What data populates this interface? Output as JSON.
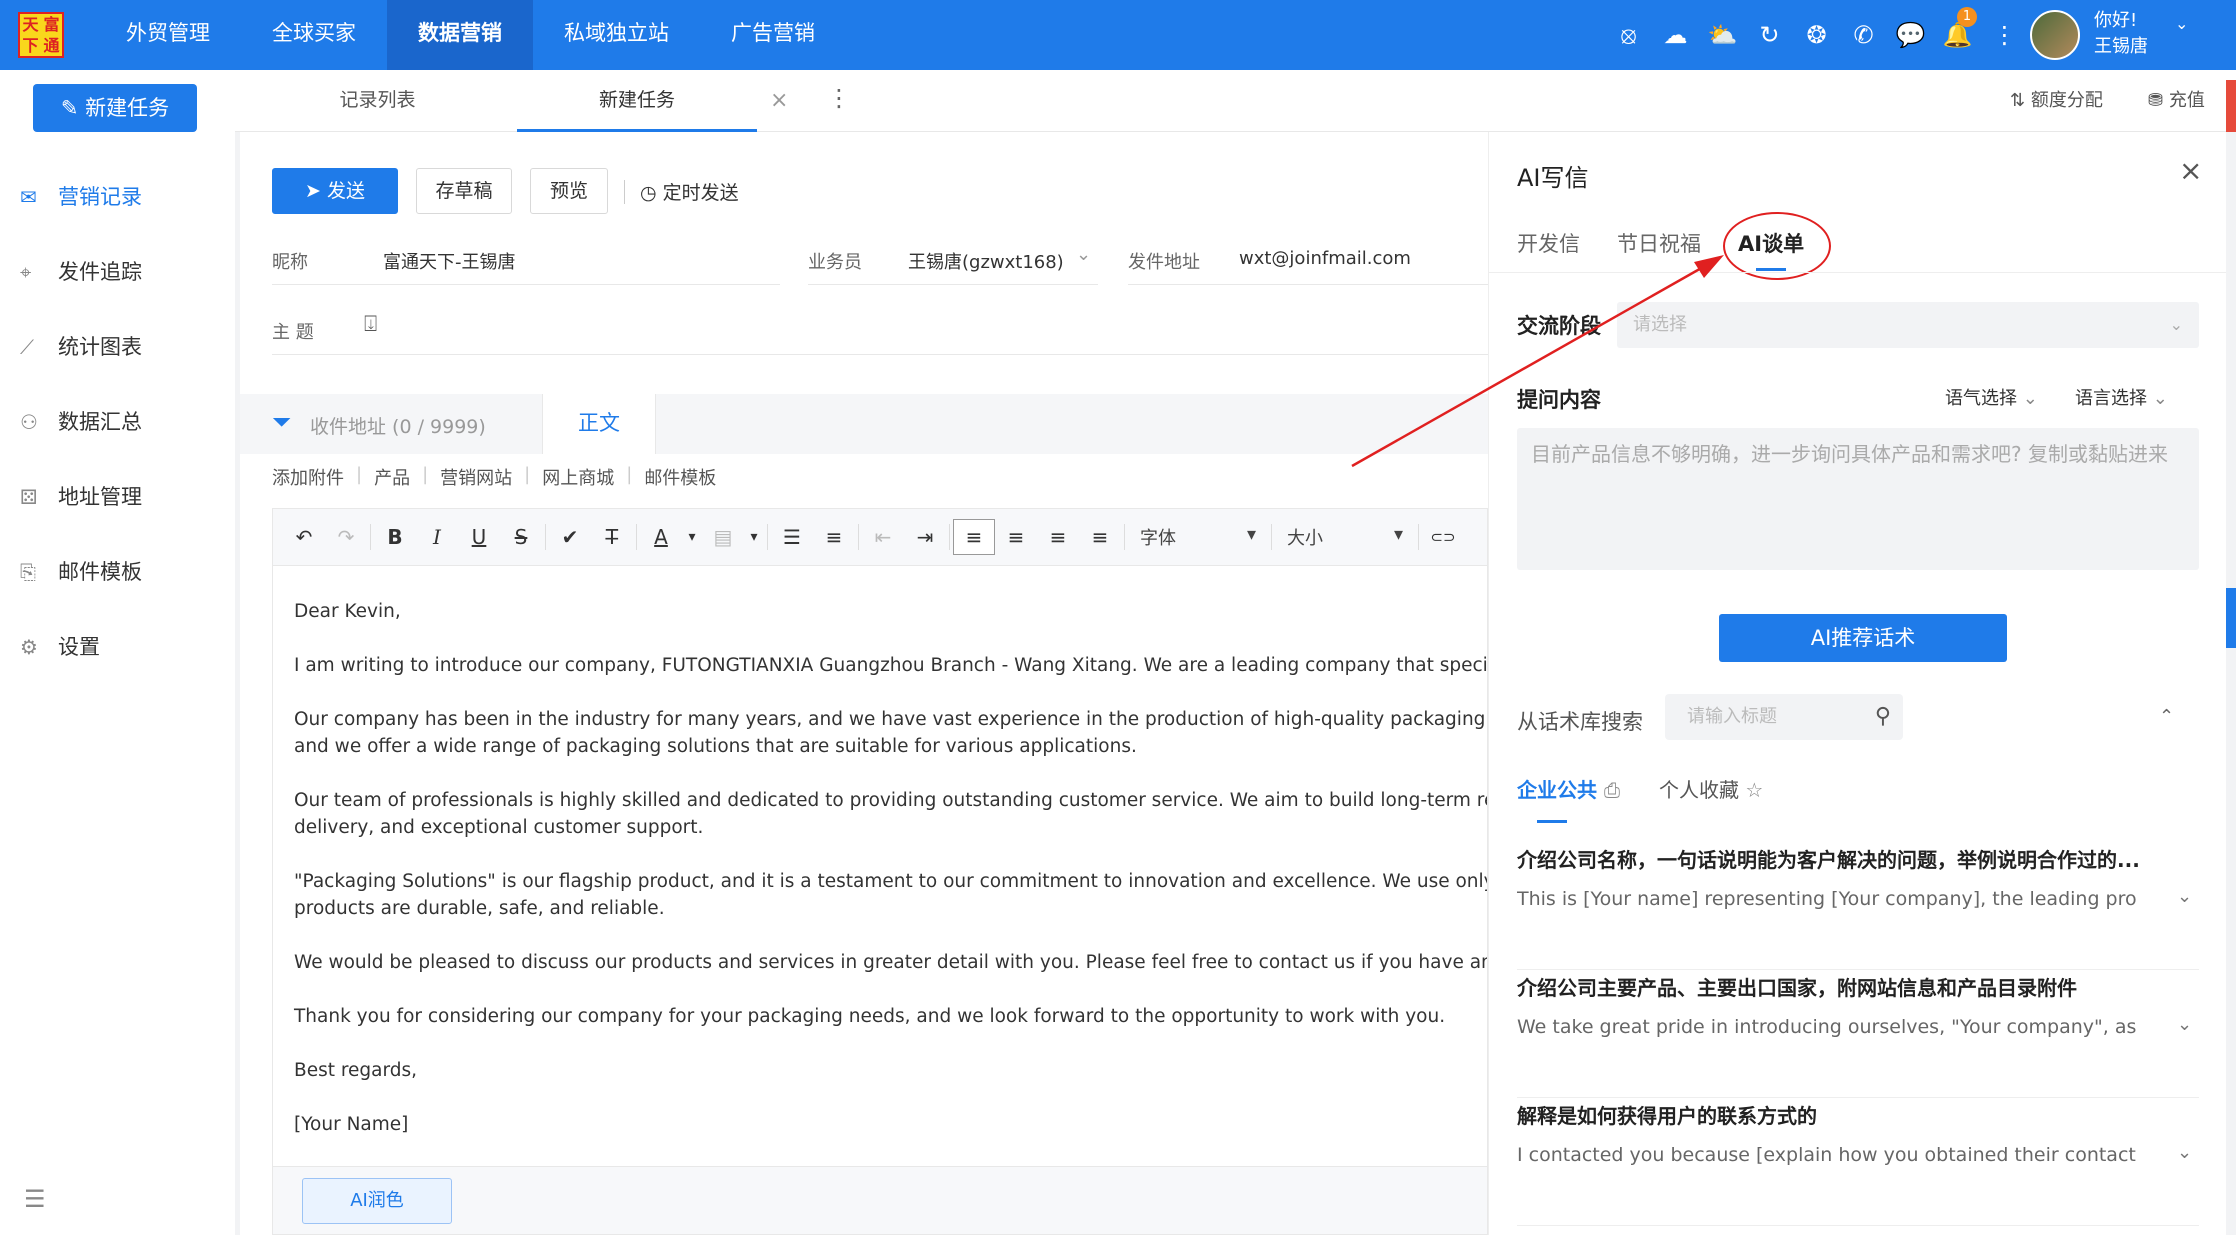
{
  "logo": {
    "chars": [
      "天",
      "富",
      "下",
      "通"
    ]
  },
  "topnav": [
    {
      "label": "外贸管理",
      "active": false
    },
    {
      "label": "全球买家",
      "active": false
    },
    {
      "label": "数据营销",
      "active": true
    },
    {
      "label": "私域独立站",
      "active": false
    },
    {
      "label": "广告营销",
      "active": false
    }
  ],
  "top_icons": {
    "openai": "⦻",
    "cloud": "☁",
    "cloud2": "⛅",
    "rotate": "↻",
    "fire": "❂",
    "phone": "✆",
    "chat": "💬",
    "bell": "🔔",
    "more": "⋮"
  },
  "notification_count": "1",
  "user": {
    "greeting": "你好!",
    "name": "王锡唐",
    "caret": "⌄"
  },
  "sidebar": {
    "new_task": "新建任务",
    "new_task_icon": "✎",
    "items": [
      {
        "label": "营销记录",
        "icon": "✉",
        "active": true
      },
      {
        "label": "发件追踪",
        "icon": "⌖",
        "active": false
      },
      {
        "label": "统计图表",
        "icon": "⟋",
        "active": false
      },
      {
        "label": "数据汇总",
        "icon": "⚇",
        "active": false
      },
      {
        "label": "地址管理",
        "icon": "⚄",
        "active": false
      },
      {
        "label": "邮件模板",
        "icon": "⎘",
        "active": false
      },
      {
        "label": "设置",
        "icon": "⚙",
        "active": false
      }
    ],
    "menu_icon": "☰"
  },
  "tabs": {
    "records": "记录列表",
    "new_task": "新建任务",
    "close": "×",
    "more": "⋮",
    "quota": "额度分配",
    "quota_icon": "⇅",
    "recharge": "充值",
    "recharge_icon": "⛃"
  },
  "compose": {
    "send": "发送",
    "send_icon": "➤",
    "draft": "存草稿",
    "preview": "预览",
    "schedule": "定时发送",
    "schedule_icon": "◷",
    "nickname_label": "昵称",
    "nickname_value": "富通天下-王锡唐",
    "salesperson_label": "业务员",
    "salesperson_value": "王锡唐(gzwxt168)",
    "dropdown_caret": "⌄",
    "sender_label": "发件地址",
    "sender_value": "wxt@joinfmail.com",
    "subject_label": "主 题",
    "subject_icon": "⍗",
    "filter_icon": "⏷",
    "recipients": "收件地址 (0 / 9999)",
    "body_tab": "正文",
    "attach": [
      "添加附件",
      "产品",
      "营销网站",
      "网上商城",
      "邮件模板"
    ],
    "font_label": "字体",
    "size_label": "大小",
    "ai_polish": "AI润色",
    "collapse": "›"
  },
  "toolbar_icons": {
    "undo": "↶",
    "redo": "↷",
    "bold": "B",
    "italic": "I",
    "underline": "U",
    "strike": "S",
    "brush": "✔",
    "clear": "T̶",
    "color": "A",
    "bg": "▤",
    "ol": "☰",
    "ul": "≡",
    "outdent": "⇤",
    "indent": "⇥",
    "left": "≡",
    "center": "≡",
    "right": "≡",
    "justify": "≡",
    "link": "⊂⊃",
    "caret": "▾"
  },
  "email_lines": [
    "Dear Kevin,",
    "I am writing to introduce our company, FUTONGTIANXIA Guangzhou Branch - Wang Xitang. We are a leading company that specializes in",
    "Our company has been in the industry for many years, and we have vast experience in the production of high-quality packaging solutions",
    "and we offer a wide range of packaging solutions that are suitable for various applications.",
    "Our team of professionals is highly skilled and dedicated to providing outstanding customer service. We aim to build long-term relationsh",
    "delivery, and exceptional customer support.",
    "\"Packaging Solutions\" is our flagship product, and it is a testament to our commitment to innovation and excellence. We use only the high",
    "products are durable, safe, and reliable.",
    "We would be pleased to discuss our products and services in greater detail with you. Please feel free to contact us if you have any questio",
    "Thank you for considering our company for your packaging needs, and we look forward to the opportunity to work with you.",
    "Best regards,",
    "[Your Name]"
  ],
  "ai": {
    "title": "AI写信",
    "close": "×",
    "tabs": [
      "开发信",
      "节日祝福",
      "AI谈单"
    ],
    "stage_label": "交流阶段",
    "stage_placeholder": "请选择",
    "question_label": "提问内容",
    "tone": "语气选择",
    "language": "语言选择",
    "caret": "⌄",
    "question_placeholder": "目前产品信息不够明确，进一步询问具体产品和需求吧? 复制或黏贴进来",
    "recommend": "AI推荐话术",
    "search_label": "从话术库搜索",
    "search_placeholder": "请输入标题",
    "search_icon": "⚲",
    "collapse_icon": "⌃",
    "categories": [
      "企业公共",
      "个人收藏"
    ],
    "cat_icons": [
      "⎙",
      "☆"
    ],
    "expand_icon": "⌄",
    "scripts": [
      {
        "title": "介绍公司名称，一句话说明能为客户解决的问题，举例说明合作过的...",
        "text": "This is [Your name] representing [Your company], the leading pro"
      },
      {
        "title": "介绍公司主要产品、主要出口国家，附网站信息和产品目录附件",
        "text": "We take great pride in introducing ourselves, \"Your company\", as"
      },
      {
        "title": "解释是如何获得用户的联系方式的",
        "text": "I contacted you because [explain how you obtained their contact i"
      },
      {
        "title": "",
        "text": ""
      }
    ]
  },
  "colors": {
    "primary": "#1f7be9",
    "annotation": "#e02020",
    "badge": "#f5901e"
  }
}
